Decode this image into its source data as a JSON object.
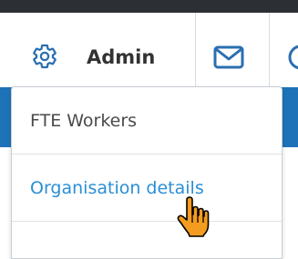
{
  "header": {
    "admin_label": "Admin",
    "icons": {
      "admin": "gear-icon",
      "messages": "envelope-icon",
      "partial": "circle-icon"
    }
  },
  "dropdown": {
    "items": [
      {
        "label": "FTE Workers"
      },
      {
        "label": "Organisation details",
        "state": "hovered"
      }
    ]
  },
  "colors": {
    "topbar": "#2c2f33",
    "accent": "#1e73b8",
    "link_hover": "#2a8fd6",
    "text": "#333333"
  }
}
